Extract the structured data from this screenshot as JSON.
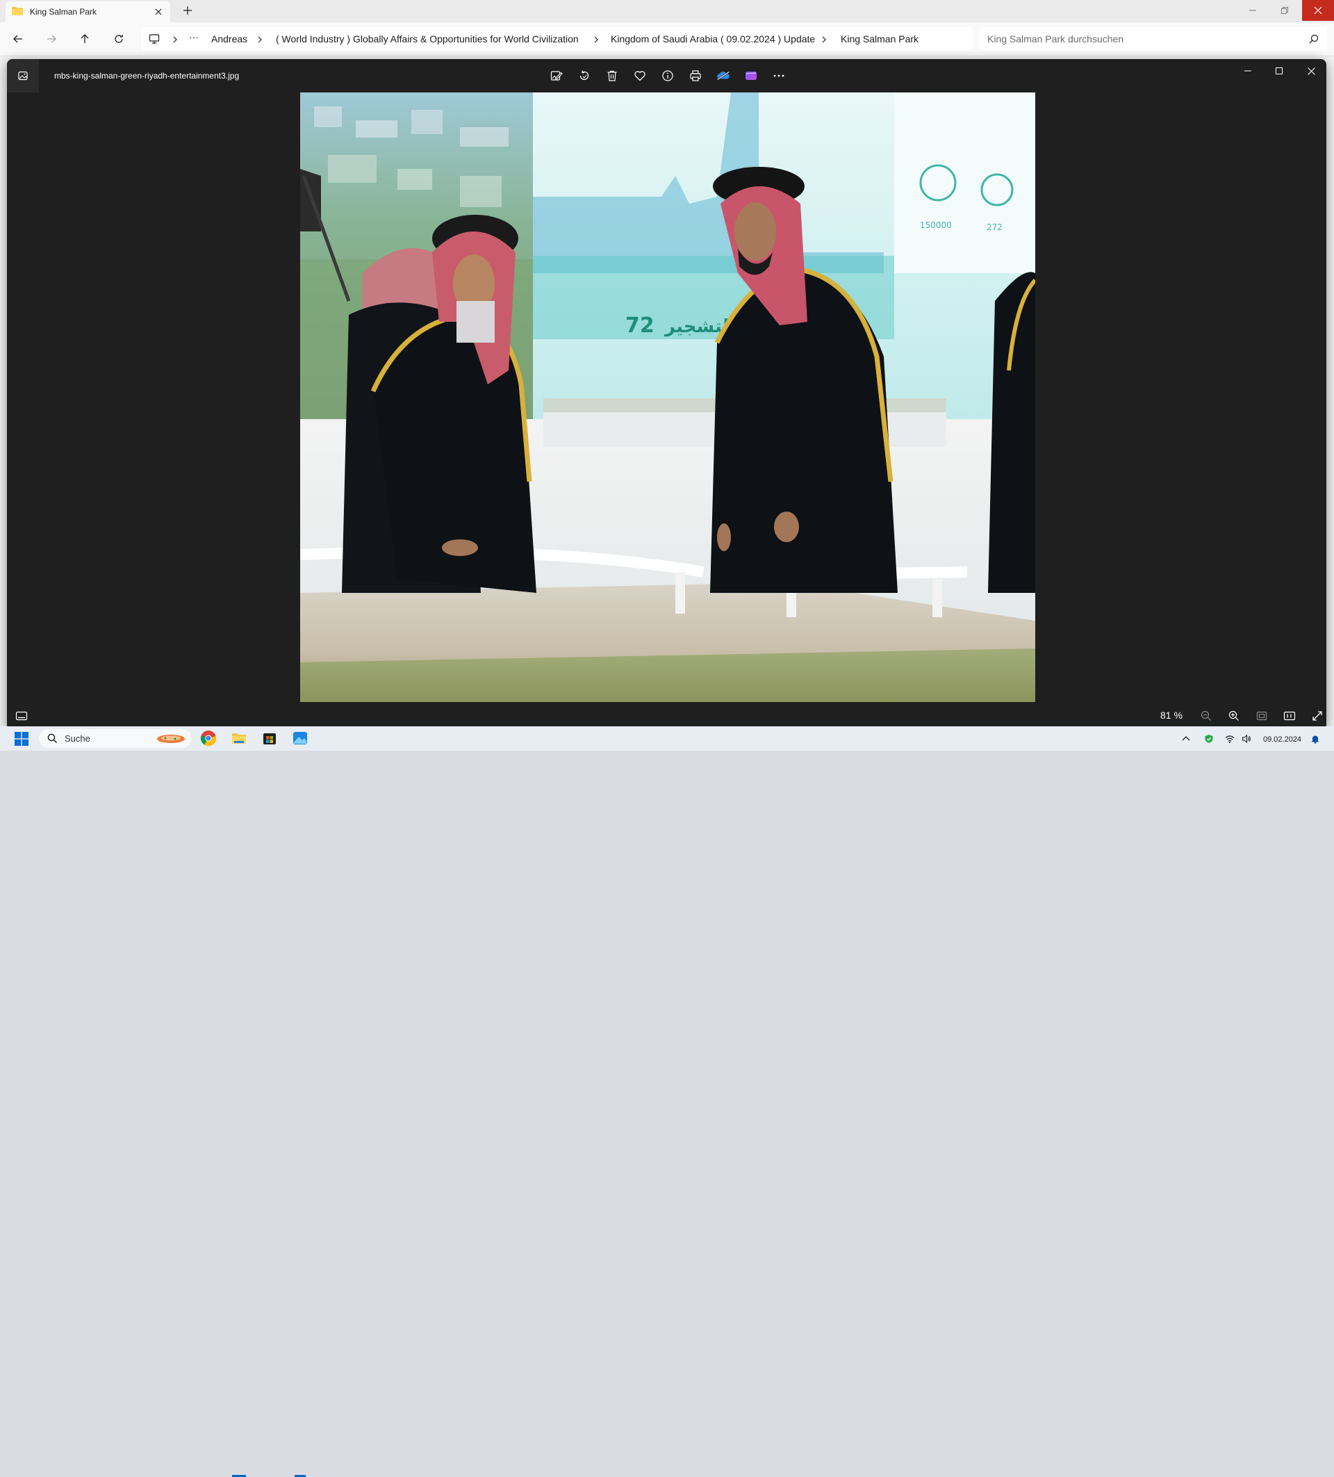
{
  "explorer": {
    "tab_title": "King Salman Park",
    "breadcrumbs": [
      "Andreas",
      "( World Industry ) Globally Affairs & Opportunities for World Civilization",
      "Kingdom of Saudi Arabia ( 09.02.2024 ) Update",
      "King Salman Park"
    ],
    "more_label": "···",
    "search_placeholder": "King Salman Park durchsuchen"
  },
  "viewer": {
    "filename": "mbs-king-salman-green-riyadh-entertainment3.jpg",
    "toolbar_icons": [
      "edit-image-icon",
      "rotate-icon",
      "delete-icon",
      "favorite-icon",
      "info-icon",
      "print-icon",
      "onedrive-icon",
      "clipchamp-icon",
      "more-icon"
    ],
    "zoom_level": "81 %",
    "photo": {
      "screen_number": "72",
      "screen_text_ar": "التشجير",
      "stat_1": "150000",
      "stat_2": "272"
    }
  },
  "taskbar": {
    "search_placeholder": "Suche",
    "date": "09.02.2024"
  },
  "colors": {
    "accent": "#0067c0",
    "close_red": "#c42b1c",
    "viewer_bg": "#1f1f1f",
    "folder_yellow": "#f4c542"
  }
}
